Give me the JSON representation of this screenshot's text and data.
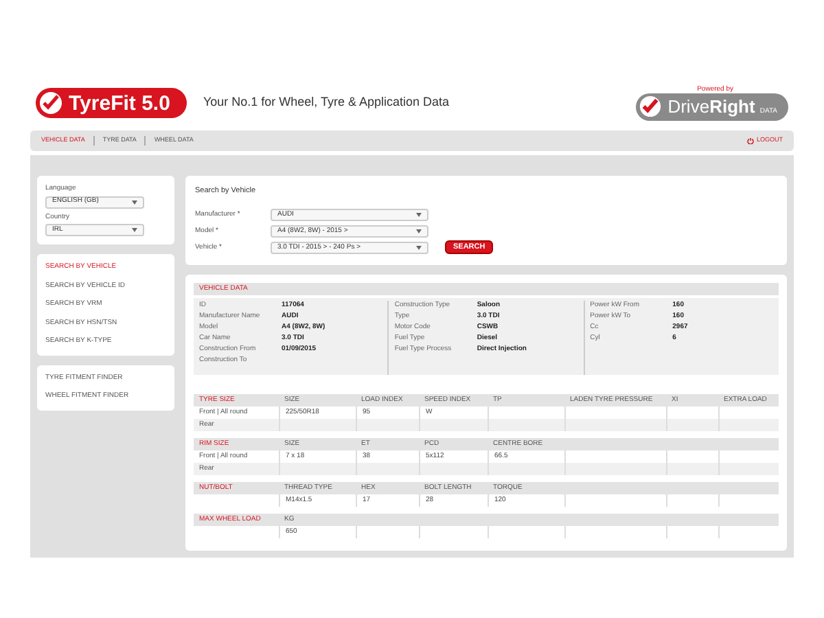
{
  "header": {
    "logo": {
      "name": "TyreFit",
      "version": "5.0"
    },
    "tagline": "Your No.1 for Wheel, Tyre & Application Data",
    "partner": {
      "powered_by": "Powered by",
      "name_light": "Drive",
      "name_bold": "Right",
      "suffix": "DATA"
    }
  },
  "nav": {
    "tabs": [
      {
        "label": "VEHICLE DATA",
        "selected": true
      },
      {
        "label": "TYRE DATA",
        "selected": false
      },
      {
        "label": "WHEEL DATA",
        "selected": false
      }
    ],
    "logout": "LOGOUT"
  },
  "sidebar": {
    "settings": [
      {
        "label": "Language",
        "value": "ENGLISH (GB)"
      },
      {
        "label": "Country",
        "value": "IRL"
      }
    ],
    "search_links": [
      {
        "label": "SEARCH BY VEHICLE",
        "selected": true
      },
      {
        "label": "SEARCH BY VEHICLE ID",
        "selected": false
      },
      {
        "label": "SEARCH BY VRM",
        "selected": false
      },
      {
        "label": "SEARCH BY HSN/TSN",
        "selected": false
      },
      {
        "label": "SEARCH BY K-TYPE",
        "selected": false
      }
    ],
    "finders": [
      {
        "label": "TYRE FITMENT FINDER"
      },
      {
        "label": "WHEEL FITMENT FINDER"
      }
    ]
  },
  "search": {
    "title": "Search by Vehicle",
    "fields": [
      {
        "label": "Manufacturer *",
        "value": "AUDI"
      },
      {
        "label": "Model *",
        "value": "A4 (8W2, 8W) - 2015 >"
      },
      {
        "label": "Vehicle *",
        "value": "3.0 TDI - 2015 > - 240 Ps >"
      }
    ],
    "button": "SEARCH"
  },
  "vehicle_data": {
    "title": "VEHICLE DATA",
    "columns": [
      [
        {
          "label": "ID",
          "value": "117064"
        },
        {
          "label": "Manufacturer Name",
          "value": "AUDI"
        },
        {
          "label": "Model",
          "value": "A4 (8W2, 8W)"
        },
        {
          "label": "Car Name",
          "value": "3.0 TDI"
        },
        {
          "label": "Construction From",
          "value": "01/09/2015"
        },
        {
          "label": "Construction To"
        }
      ],
      [
        {
          "label": "Construction Type",
          "value": "Saloon"
        },
        {
          "label": "Type",
          "value": "3.0 TDI"
        },
        {
          "label": "Motor Code",
          "value": "CSWB"
        },
        {
          "label": "Fuel Type",
          "value": "Diesel"
        },
        {
          "label": "Fuel Type Process",
          "value": "Direct Injection"
        }
      ],
      [
        {
          "label": "Power kW From",
          "value": "160"
        },
        {
          "label": "Power kW To",
          "value": "160"
        },
        {
          "label": "Cc",
          "value": "2967"
        },
        {
          "label": "Cyl",
          "value": "6"
        }
      ]
    ]
  },
  "tables": [
    {
      "title": "TYRE SIZE",
      "columns": [
        "SIZE",
        "LOAD INDEX",
        "SPEED INDEX",
        "TP",
        "LADEN TYRE PRESSURE",
        "XI",
        "EXTRA LOAD"
      ],
      "rows": [
        {
          "label": "Front | All round",
          "values": [
            "225/50R18",
            "95",
            "W"
          ]
        },
        {
          "label": "Rear"
        }
      ]
    },
    {
      "title": "RIM SIZE",
      "columns": [
        "SIZE",
        "ET",
        "PCD",
        "CENTRE BORE"
      ],
      "rows": [
        {
          "label": "Front | All round",
          "values": [
            "7 x 18",
            "38",
            "5x112",
            "66.5"
          ]
        },
        {
          "label": "Rear"
        }
      ]
    },
    {
      "title": "NUT/BOLT",
      "columns": [
        "THREAD TYPE",
        "HEX",
        "BOLT LENGTH",
        "TORQUE"
      ],
      "rows": [
        {
          "values": [
            "M14x1.5",
            "17",
            "28",
            "120"
          ]
        }
      ]
    },
    {
      "title": "MAX WHEEL LOAD",
      "columns": [
        "KG"
      ],
      "rows": [
        {
          "values": [
            "650"
          ]
        }
      ]
    }
  ]
}
